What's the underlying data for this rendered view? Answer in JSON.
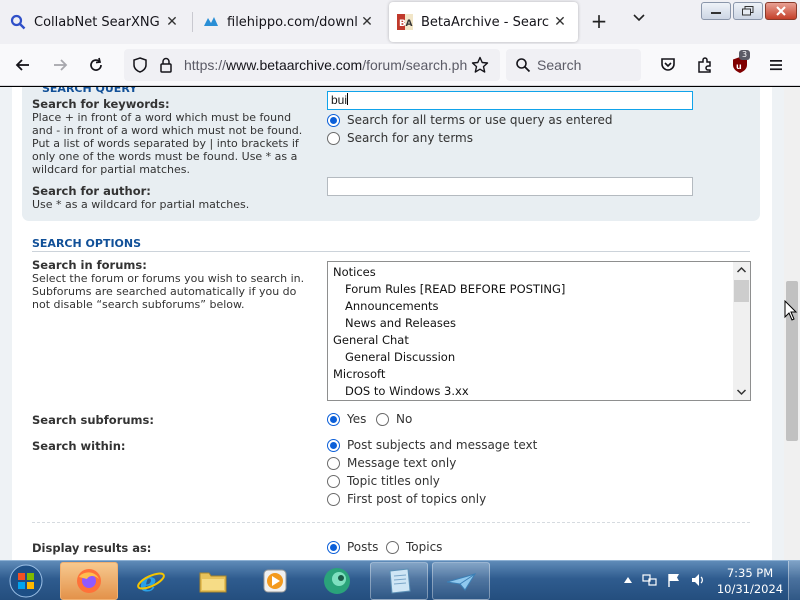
{
  "browser": {
    "tabs": [
      {
        "title": "CollabNet SearXNG",
        "active": false,
        "icon": "search-favicon"
      },
      {
        "title": "filehippo.com/download_",
        "active": false,
        "icon": "filehippo-favicon"
      },
      {
        "title": "BetaArchive - Search",
        "active": true,
        "icon": "betaarchive-favicon"
      }
    ],
    "url": {
      "prefix": "https://",
      "host": "www.betaarchive.com",
      "path": "/forum/search.ph"
    },
    "search_placeholder": "Search",
    "extension_badge": "3"
  },
  "page": {
    "partial_heading": "SEARCH QUERY",
    "keywords": {
      "label": "Search for keywords:",
      "explain_lines": [
        "Place + in front of a word which must be found",
        "and - in front of a word which must not be found.",
        "Put a list of words separated by | into brackets if",
        "only one of the words must be found. Use * as a",
        "wildcard for partial matches."
      ],
      "value": "bui",
      "options": [
        {
          "label": "Search for all terms or use query as entered",
          "checked": true
        },
        {
          "label": "Search for any terms",
          "checked": false
        }
      ]
    },
    "author": {
      "label": "Search for author:",
      "explain": "Use * as a wildcard for partial matches.",
      "value": ""
    },
    "options_heading": "SEARCH OPTIONS",
    "forums": {
      "label": "Search in forums:",
      "explain_lines": [
        "Select the forum or forums you wish to search in.",
        "Subforums are searched automatically if you do",
        "not disable “search subforums” below."
      ],
      "items": [
        {
          "name": "Notices",
          "sub": false
        },
        {
          "name": "Forum Rules [READ BEFORE POSTING]",
          "sub": true
        },
        {
          "name": "Announcements",
          "sub": true
        },
        {
          "name": "News and Releases",
          "sub": true
        },
        {
          "name": "General Chat",
          "sub": false
        },
        {
          "name": "General Discussion",
          "sub": true
        },
        {
          "name": "Microsoft",
          "sub": false
        },
        {
          "name": "DOS to Windows 3.xx",
          "sub": true
        }
      ]
    },
    "subforums": {
      "label": "Search subforums:",
      "options": [
        {
          "label": "Yes",
          "checked": true
        },
        {
          "label": "No",
          "checked": false
        }
      ]
    },
    "within": {
      "label": "Search within:",
      "options": [
        {
          "label": "Post subjects and message text",
          "checked": true
        },
        {
          "label": "Message text only",
          "checked": false
        },
        {
          "label": "Topic titles only",
          "checked": false
        },
        {
          "label": "First post of topics only",
          "checked": false
        }
      ]
    },
    "display": {
      "label": "Display results as:",
      "options": [
        {
          "label": "Posts",
          "checked": true
        },
        {
          "label": "Topics",
          "checked": false
        }
      ]
    }
  },
  "taskbar": {
    "apps": [
      "start-orb",
      "firefox",
      "internet-explorer",
      "file-explorer",
      "media-player",
      "app-teal",
      "app-notepad",
      "app-plane"
    ],
    "time": "7:35 PM",
    "date": "10/31/2024"
  },
  "colors": {
    "accent": "#115098",
    "radio_on": "#0b5fd9",
    "focus_border": "#11a3ea"
  }
}
